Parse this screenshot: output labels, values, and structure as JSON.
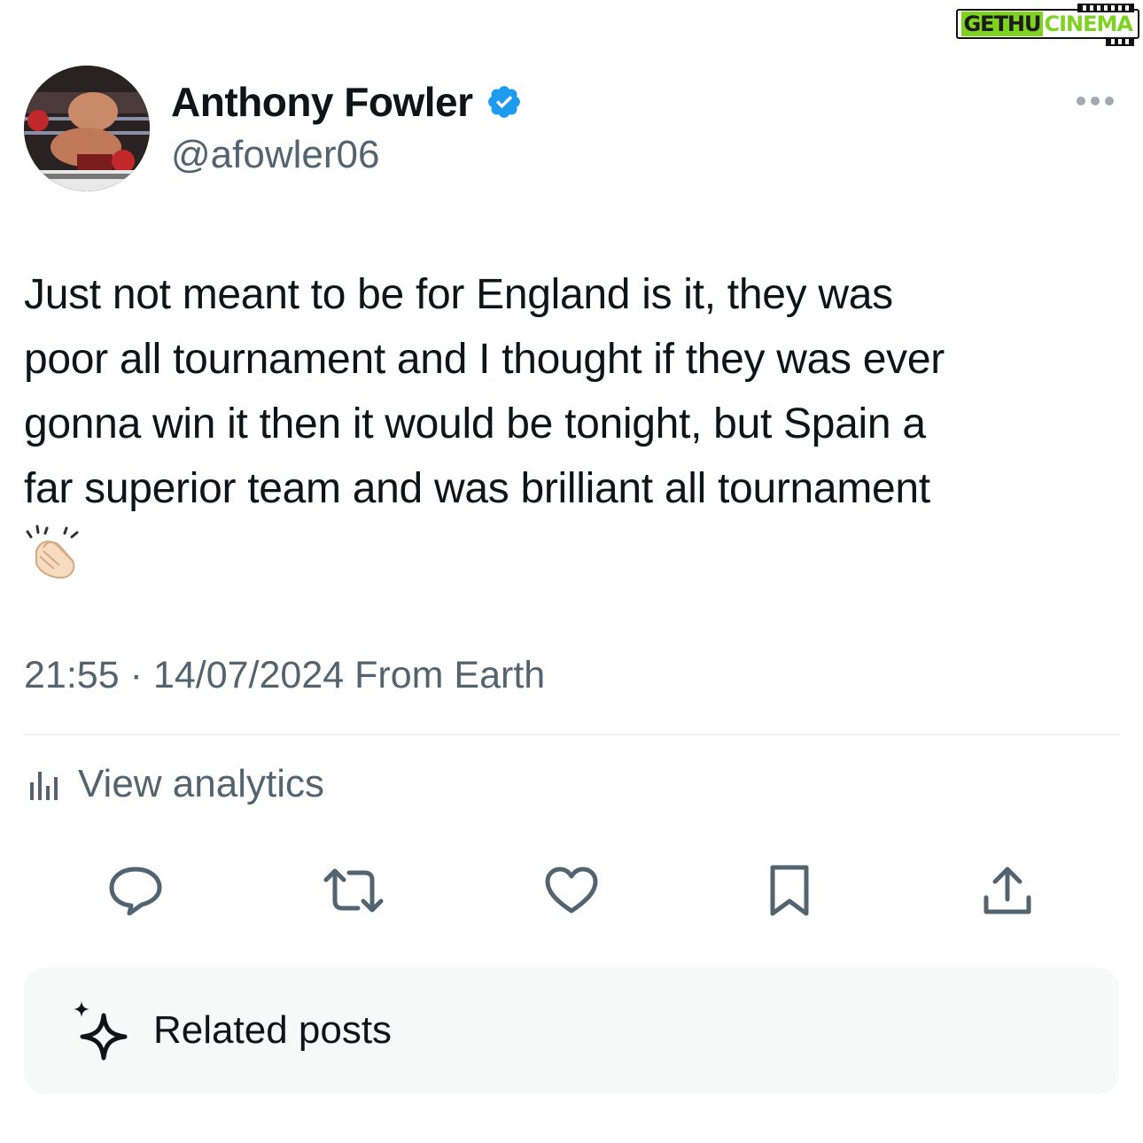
{
  "watermark": {
    "part1": "GETHU",
    "part2": "CINEMA"
  },
  "author": {
    "name": "Anthony Fowler",
    "handle": "@afowler06",
    "verified": true,
    "avatar_icon": "boxer-photo"
  },
  "tweet": {
    "lines": [
      "Just not meant to be for England is it,  they was",
      "poor all tournament and I thought if they was ever",
      "gonna win it then it would be tonight,  but Spain a",
      "far superior team and was brilliant all tournament"
    ],
    "emoji": "clapping-hands"
  },
  "meta": {
    "time": "21:55",
    "separator": "·",
    "date": "14/07/2024",
    "location": "From Earth"
  },
  "analytics": {
    "label": "View analytics",
    "icon": "bar-chart-icon"
  },
  "actions": [
    {
      "icon": "reply-icon"
    },
    {
      "icon": "retweet-icon"
    },
    {
      "icon": "like-icon"
    },
    {
      "icon": "bookmark-icon"
    },
    {
      "icon": "share-icon"
    }
  ],
  "related": {
    "label": "Related posts",
    "icon": "sparkle-icon"
  },
  "colors": {
    "text": "#0f1419",
    "secondary": "#536471",
    "verified": "#1d9bf0",
    "divider": "#eff3f4",
    "card": "#f7f9f9"
  }
}
